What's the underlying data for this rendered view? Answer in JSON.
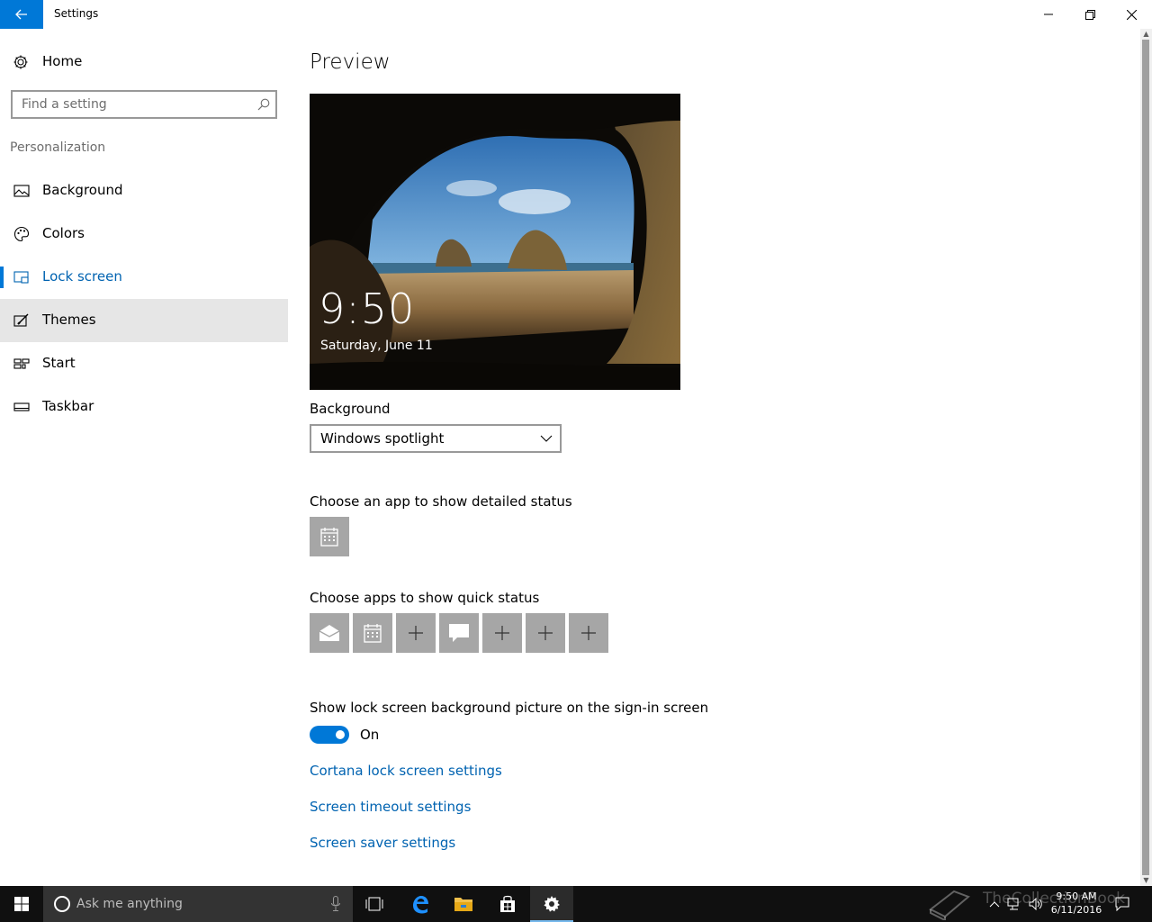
{
  "window": {
    "title": "Settings"
  },
  "sidebar": {
    "home_label": "Home",
    "search_placeholder": "Find a setting",
    "section_title": "Personalization",
    "items": [
      {
        "label": "Background",
        "icon": "picture-icon"
      },
      {
        "label": "Colors",
        "icon": "palette-icon"
      },
      {
        "label": "Lock screen",
        "icon": "lock-screen-icon",
        "selected": true
      },
      {
        "label": "Themes",
        "icon": "themes-icon",
        "hover": true
      },
      {
        "label": "Start",
        "icon": "start-icon"
      },
      {
        "label": "Taskbar",
        "icon": "taskbar-icon"
      }
    ]
  },
  "main": {
    "title": "Preview",
    "preview": {
      "time": "9:50",
      "date": "Saturday, June 11"
    },
    "background_label": "Background",
    "background_value": "Windows spotlight",
    "detailed_status_label": "Choose an app to show detailed status",
    "quick_status_label": "Choose apps to show quick status",
    "quick_status_tiles": [
      "mail-icon",
      "calendar-icon",
      "plus-icon",
      "message-icon",
      "plus-icon",
      "plus-icon",
      "plus-icon"
    ],
    "signin_label": "Show lock screen background picture on the sign-in screen",
    "signin_toggle_state": "On",
    "links": [
      "Cortana lock screen settings",
      "Screen timeout settings",
      "Screen saver settings"
    ]
  },
  "taskbar": {
    "search_placeholder": "Ask me anything",
    "time": "9:50 AM",
    "date": "6/11/2016",
    "watermark": "TheCollectionBook"
  },
  "colors": {
    "accent": "#0078d7",
    "link": "#0063b1",
    "taskbar": "#101010"
  }
}
